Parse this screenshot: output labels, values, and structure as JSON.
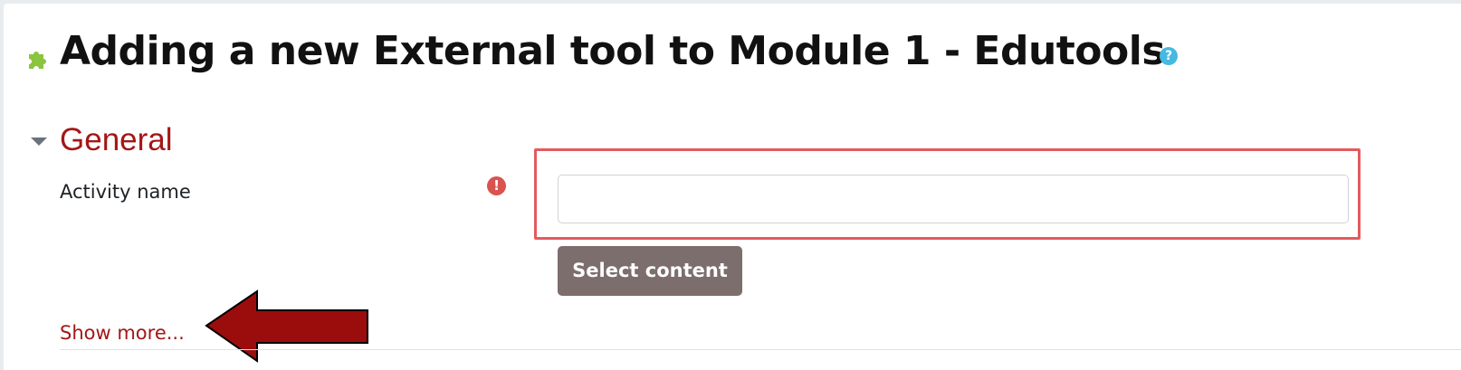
{
  "page": {
    "title": "Adding a new External tool to Module 1 - Edutools",
    "help_icon_glyph": "?",
    "icons": {
      "module_icon": "puzzle-piece-icon",
      "help_icon": "question-circle-icon"
    },
    "colors": {
      "section_title": "#a31717",
      "help_icon": "#46b9e0",
      "required_icon": "#d9534f",
      "select_button_bg": "#7c6e6d",
      "highlight_border": "#e35a5e",
      "callout_arrow": "#9b0d0d",
      "module_icon": "#8ac53f"
    }
  },
  "general_section": {
    "title": "General",
    "toggle_icon": "caret-down-icon",
    "expanded": true,
    "activity_name": {
      "label": "Activity name",
      "required": true,
      "required_icon_glyph": "!",
      "value": "",
      "placeholder": ""
    },
    "select_content_label": "Select content",
    "show_more_label": "Show more..."
  }
}
